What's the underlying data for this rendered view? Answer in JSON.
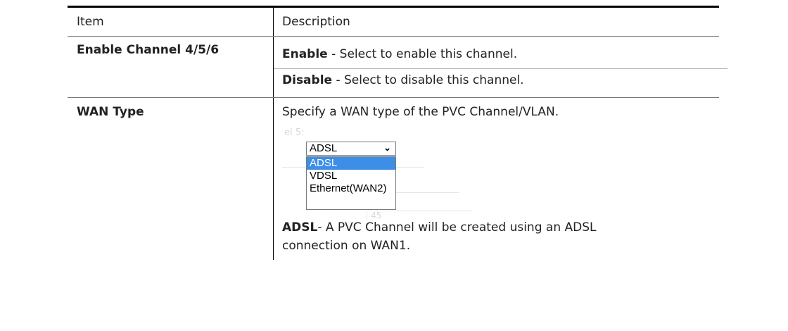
{
  "table": {
    "header": {
      "item": "Item",
      "description": "Description"
    },
    "rows": [
      {
        "item": "Enable Channel 4/5/6",
        "lines": [
          {
            "term": "Enable",
            "text": " - Select to enable this channel."
          },
          {
            "term": "Disable",
            "text": " - Select to disable this channel."
          }
        ]
      },
      {
        "item": "WAN Type",
        "intro": "Specify a WAN type of the PVC Channel/VLAN.",
        "figure": {
          "ghost_label": "el 5:",
          "selected_value": "ADSL",
          "chevron_icon": "chevron-down-icon",
          "options": [
            "ADSL",
            "VDSL",
            "Ethernet(WAN2)"
          ],
          "highlighted_option": "ADSL",
          "highlight_color": "#3d8ee6",
          "ghost_value": "45"
        },
        "term": "ADSL",
        "text_line1": "- A PVC Channel will be created using an ADSL",
        "text_line2": "connection on WAN1."
      }
    ]
  }
}
